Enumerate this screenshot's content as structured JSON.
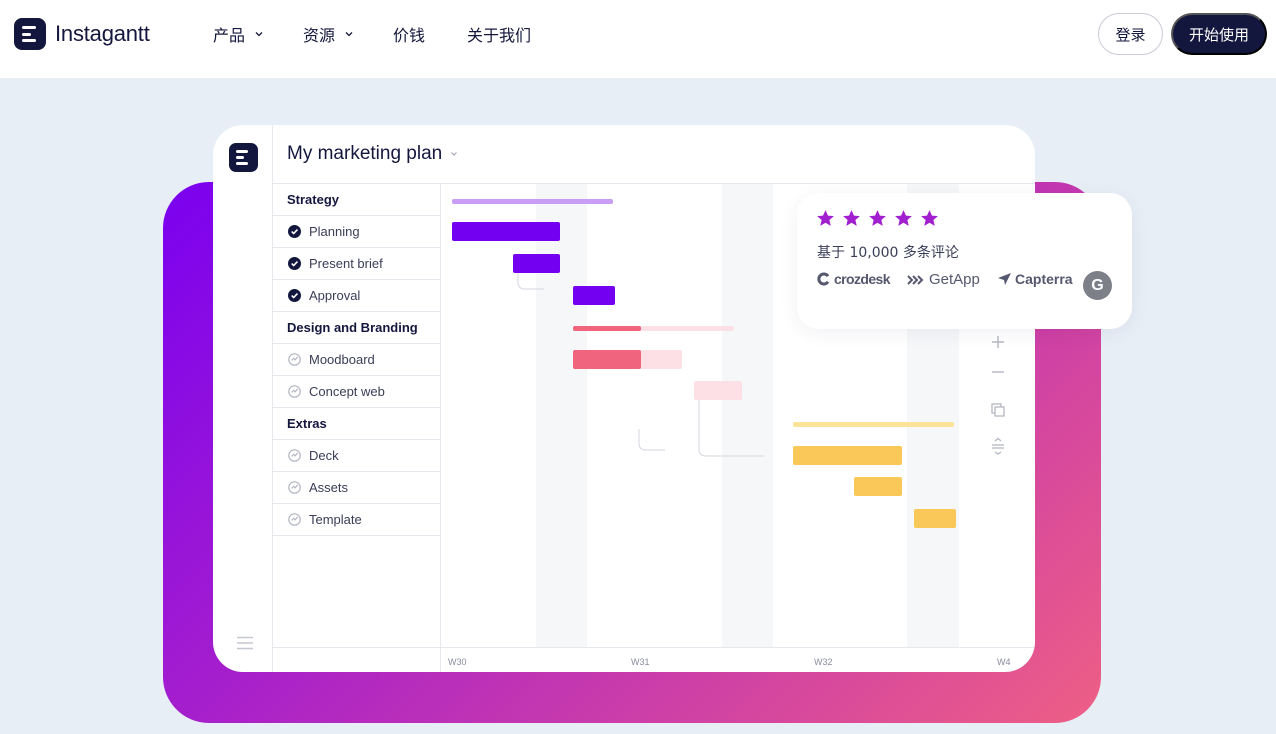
{
  "brand": {
    "name": "Instagantt",
    "icon": "instagantt-logo-icon"
  },
  "nav": {
    "items": [
      {
        "label": "产品",
        "has_dropdown": true
      },
      {
        "label": "资源",
        "has_dropdown": true
      },
      {
        "label": "价钱",
        "has_dropdown": false
      },
      {
        "label": "关于我们",
        "has_dropdown": false
      }
    ],
    "login_label": "登录",
    "start_label": "开始使用"
  },
  "colors": {
    "navy": "#14173d",
    "purple": "#7300f0",
    "purple_light": "#c99cf5",
    "pink": "#f0647e",
    "pink_light": "#fde0e6",
    "yellow": "#f9c859",
    "yellow_light": "#fbe39a",
    "gradient_start": "#7a00f0",
    "gradient_end": "#ee5f85",
    "background": "#e8eef6"
  },
  "app": {
    "title": "My marketing plan",
    "tasks": [
      {
        "label": "Strategy",
        "type": "group"
      },
      {
        "label": "Planning",
        "type": "task",
        "status": "done"
      },
      {
        "label": "Present brief",
        "type": "task",
        "status": "done"
      },
      {
        "label": "Approval",
        "type": "task",
        "status": "done"
      },
      {
        "label": "Design and Branding",
        "type": "group"
      },
      {
        "label": "Moodboard",
        "type": "task",
        "status": "in-progress"
      },
      {
        "label": "Concept web",
        "type": "task",
        "status": "in-progress"
      },
      {
        "label": "Extras",
        "type": "group"
      },
      {
        "label": "Deck",
        "type": "task",
        "status": "in-progress"
      },
      {
        "label": "Assets",
        "type": "task",
        "status": "in-progress"
      },
      {
        "label": "Template",
        "type": "task",
        "status": "in-progress"
      }
    ],
    "weeks": [
      "W30",
      "W31",
      "W32",
      "W4"
    ],
    "tools": [
      "zoom-in-icon",
      "zoom-out-icon",
      "duplicate-icon",
      "expand-rows-icon"
    ],
    "rail_icons": [
      "app-logo-icon",
      "menu-icon"
    ]
  },
  "review": {
    "rating": 5,
    "max_rating": 5,
    "text": "基于 10,000 多条评论",
    "platforms": [
      {
        "name": "crozdesk",
        "icon": "crozdesk-logo-icon"
      },
      {
        "name": "GetApp",
        "icon": "getapp-logo-icon"
      },
      {
        "name": "Capterra",
        "icon": "capterra-logo-icon"
      },
      {
        "name": "G",
        "icon": "g2-logo-icon"
      }
    ]
  }
}
